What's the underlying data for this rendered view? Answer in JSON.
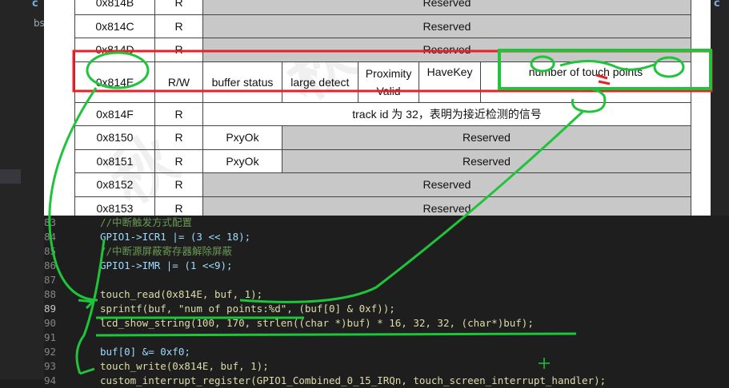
{
  "sidebar": {
    "c_label": "c",
    "bs_label": "bs"
  },
  "right_tab": {
    "label": "c"
  },
  "register_table": {
    "rows": [
      {
        "addr": "0x814B",
        "rw": "R",
        "desc": "Reserved"
      },
      {
        "addr": "0x814C",
        "rw": "R",
        "desc": "Reserved"
      },
      {
        "addr": "0x814D",
        "rw": "R",
        "desc": "Reserved"
      },
      {
        "addr": "0x814E",
        "rw": "R/W",
        "bits": [
          "buffer status",
          "large detect",
          "Proximity Valid",
          "HaveKey",
          "number of touch points"
        ]
      },
      {
        "addr": "0x814F",
        "rw": "R",
        "desc": "track id 为 32，表明为接近检测的信号"
      },
      {
        "addr": "0x8150",
        "rw": "R",
        "first": "PxyOk",
        "desc": "Reserved"
      },
      {
        "addr": "0x8151",
        "rw": "R",
        "first": "PxyOk",
        "desc": "Reserved"
      },
      {
        "addr": "0x8152",
        "rw": "R",
        "desc": "Reserved"
      },
      {
        "addr": "0x8153",
        "rw": "R",
        "desc": "Reserved"
      }
    ],
    "proximity_line1": "Proximity",
    "proximity_line2": "Valid"
  },
  "watermark": "秋",
  "code": {
    "lines": [
      {
        "n": "83",
        "text": "//中断触发方式配置"
      },
      {
        "n": "84",
        "text": "GPIO1->ICR1 |= (3 << 18);"
      },
      {
        "n": "85",
        "text": "//中断源屏蔽寄存器解除屏蔽"
      },
      {
        "n": "86",
        "text": "GPIO1->IMR |= (1 <<9);"
      },
      {
        "n": "87",
        "text": ""
      },
      {
        "n": "88",
        "text": "touch_read(0x814E, buf, 1);"
      },
      {
        "n": "89",
        "text": "sprintf(buf, \"num of points:%d\", (buf[0] & 0xf));"
      },
      {
        "n": "90",
        "text": "lcd_show_string(100, 170, strlen((char *)buf) * 16, 32, 32, (char*)buf);"
      },
      {
        "n": "91",
        "text": ""
      },
      {
        "n": "92",
        "text": "buf[0] &= 0xf0;"
      },
      {
        "n": "93",
        "text": "touch_write(0x814E, buf, 1);"
      },
      {
        "n": "94",
        "text": "custom_interrupt_register(GPIO1_Combined_0_15_IRQn, touch_screen_interrupt_handler);"
      }
    ],
    "active_line": "89"
  },
  "colors": {
    "highlight_red": "#e8202a",
    "ink_green": "#1fc43a",
    "comment": "#6a9955",
    "function": "#dcdcaa",
    "number": "#b5cea8",
    "string": "#ce9178"
  }
}
